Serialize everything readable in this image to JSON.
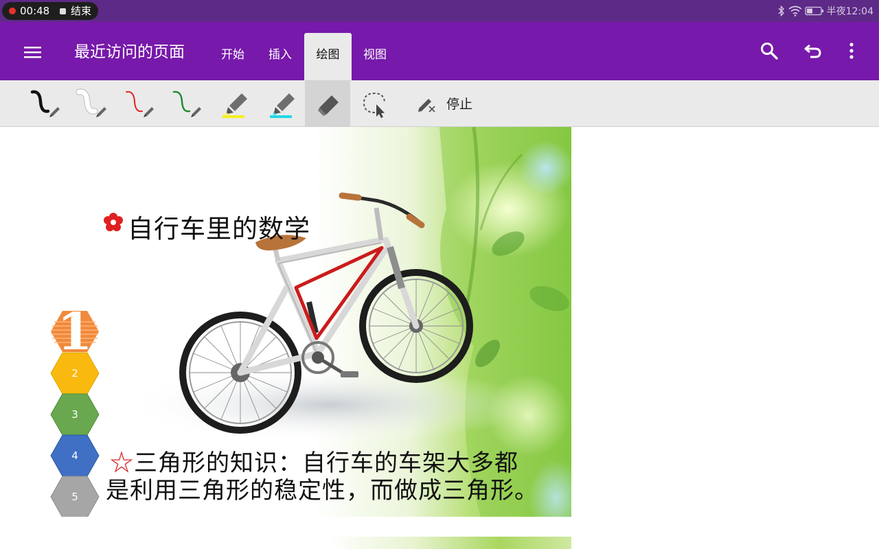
{
  "status_bar": {
    "recording_time": "00:48",
    "end_label": "结束",
    "clock": "半夜12:04",
    "icons": [
      "bluetooth-icon",
      "wifi-icon",
      "battery-icon"
    ]
  },
  "app_bar": {
    "title": "最近访问的页面",
    "tabs": [
      {
        "label": "开始"
      },
      {
        "label": "插入"
      },
      {
        "label": "绘图"
      },
      {
        "label": "视图"
      }
    ],
    "active_tab": "绘图",
    "actions": [
      "search-icon",
      "undo-icon",
      "more-vert-icon"
    ]
  },
  "draw_toolbar": {
    "tools": [
      {
        "name": "black-pen",
        "color": "#111111"
      },
      {
        "name": "white-pen",
        "color": "#ffffff"
      },
      {
        "name": "red-pen",
        "color": "#e02020"
      },
      {
        "name": "green-pen",
        "color": "#1a8a2a"
      },
      {
        "name": "yellow-highlighter",
        "color": "#f5f01e"
      },
      {
        "name": "cyan-highlighter",
        "color": "#21d8e6"
      },
      {
        "name": "eraser",
        "color": "#555555"
      },
      {
        "name": "lasso-select",
        "color": "#555555"
      }
    ],
    "selected_tool": "eraser",
    "stop_label": "停止"
  },
  "slide": {
    "title": "自行车里的数学",
    "caption_star": "☆",
    "caption_line1": "三角形的知识：自行车的车架大多都",
    "caption_line2": "是利用三角形的稳定性，而做成三角形。",
    "hex_steps": [
      {
        "label": "1",
        "color": "#f08a3c"
      },
      {
        "label": "2",
        "color": "#f9b90e"
      },
      {
        "label": "3",
        "color": "#6aa84f"
      },
      {
        "label": "4",
        "color": "#3f70c4"
      },
      {
        "label": "5",
        "color": "#a6a6a6"
      }
    ]
  },
  "colors": {
    "app_bar": "#7719aa",
    "status_bar": "#5e2a88",
    "toolbar": "#eaeaea",
    "triangle_highlight": "#cc1b1b"
  }
}
